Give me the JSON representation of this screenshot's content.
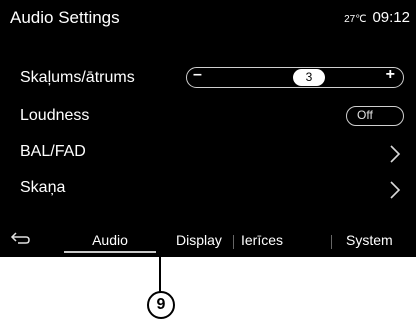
{
  "header": {
    "title": "Audio Settings",
    "temperature": "27℃",
    "time": "09:12"
  },
  "settings": {
    "volume": {
      "label": "Skaļums/ātrums",
      "minus": "–",
      "value": "3",
      "plus": "+"
    },
    "loudness": {
      "label": "Loudness",
      "state": "Off"
    },
    "bal_fad": {
      "label": "BAL/FAD"
    },
    "skana": {
      "label": "Skaņa"
    }
  },
  "tabs": [
    {
      "label": "Audio",
      "active": true
    },
    {
      "label": "Display"
    },
    {
      "label": "Ierīces"
    },
    {
      "label": "System"
    }
  ],
  "callout": {
    "number": "9"
  }
}
